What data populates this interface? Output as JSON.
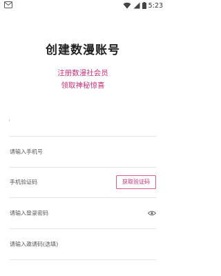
{
  "status_bar": {
    "time": "5:23"
  },
  "header": {
    "title": "创建数漫账号",
    "subtitle_line1": "注册数漫社会员",
    "subtitle_line2": "领取神秘惊喜"
  },
  "form": {
    "phone_placeholder": "请输入手机号",
    "code_placeholder": "手机验证码",
    "get_code_label": "获取验证码",
    "password_placeholder": "请输入登录密码",
    "invite_placeholder": "请输入邀请码(选填)"
  },
  "colors": {
    "accent": "#c0327a",
    "divider": "#e4e4e4"
  }
}
